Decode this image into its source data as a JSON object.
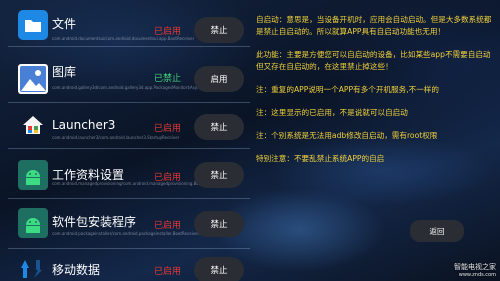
{
  "apps": [
    {
      "name": "文件",
      "package": "com.android.documentsui/com.android.documentsui.app.BootReceiver",
      "status": "已启用",
      "status_color": "#e53935",
      "button": "禁止",
      "icon": "folder-icon",
      "icon_color": "#1e88e5"
    },
    {
      "name": "图库",
      "package": "com.android.gallery3d/com.android.gallery3d.app.PackagesMonitor$AsyncService",
      "status": "已禁止",
      "status_color": "#43d17a",
      "button": "启用",
      "icon": "image-icon",
      "icon_color": "#4a7fd6"
    },
    {
      "name": "Launcher3",
      "package": "com.android.launcher3/com.android.launcher3.StartupReceiver",
      "status": "已启用",
      "status_color": "#e53935",
      "button": "禁止",
      "icon": "house-icon",
      "icon_color": "#ffffff"
    },
    {
      "name": "工作资料设置",
      "package": "com.android.managedprovisioning/com.android.managedprovisioning.BootReminder",
      "status": "已启用",
      "status_color": "#e53935",
      "button": "禁止",
      "icon": "android-icon",
      "icon_color": "#3ddc84"
    },
    {
      "name": "软件包安装程序",
      "package": "com.android.packageinstaller/com.android.packageinstaller.BootReceiver",
      "status": "已启用",
      "status_color": "#e53935",
      "button": "禁止",
      "icon": "android-icon",
      "icon_color": "#3ddc84"
    },
    {
      "name": "移动数据",
      "package": "com.android.phone/com.android.phone.OnBootReceiver",
      "status": "已启用",
      "status_color": "#e53935",
      "button": "禁止",
      "icon": "signal-icon",
      "icon_color": "#1e88e5"
    }
  ],
  "notes": [
    "自启动：意思是，当设备开机时，应用会自动启动。但是大多数系统都是禁止自启动的。所以就算APP具有自启动功能也无用！",
    "此功能：主要是方便您可以自启动的设备，比如某些app不需要自启动但又存在自启动的，在这里禁止掉这些！",
    "注：重复的APP说明一个APP有多个开机服务,不一样的",
    "注：这里显示的已启用，不是说就可以自启动",
    "注：个别系统是无法用adb修改自启动，需有root权限",
    "特别注意：不要乱禁止系统APP的自启"
  ],
  "back_button": "返回",
  "watermark": {
    "line1": "智能电视之家",
    "line2": "www.znds.com"
  }
}
